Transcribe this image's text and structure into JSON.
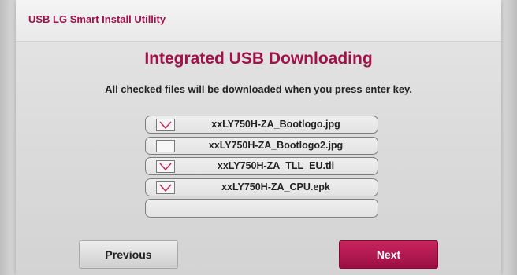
{
  "app": {
    "title": "USB LG Smart Install Utillity"
  },
  "dialog": {
    "heading": "Integrated USB Downloading",
    "instruction": "All checked files will be downloaded when you press enter key."
  },
  "files": [
    {
      "name": "xxLY750H-ZA_Bootlogo.jpg",
      "checked": true
    },
    {
      "name": "xxLY750H-ZA_Bootlogo2.jpg",
      "checked": false
    },
    {
      "name": "xxLY750H-ZA_TLL_EU.tll",
      "checked": true
    },
    {
      "name": "xxLY750H-ZA_CPU.epk",
      "checked": true
    },
    {
      "name": "",
      "checked": false
    }
  ],
  "buttons": {
    "previous": "Previous",
    "next": "Next"
  },
  "colors": {
    "accent": "#a0114a",
    "next_button": "#b01a52",
    "check_mark": "#c8245d"
  },
  "icons": {
    "check": "check-mark-icon"
  }
}
